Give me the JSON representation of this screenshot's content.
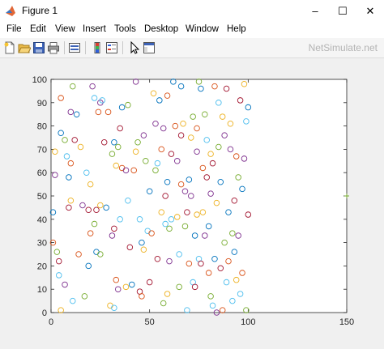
{
  "window": {
    "title": "Figure 1",
    "controls": [
      "–",
      "☐",
      "✕"
    ]
  },
  "menu": [
    "File",
    "Edit",
    "View",
    "Insert",
    "Tools",
    "Desktop",
    "Window",
    "Help"
  ],
  "toolbar": {
    "watermark": "NetSimulate.net",
    "icons": [
      "new-figure-icon",
      "open-file-icon",
      "save-icon",
      "print-icon",
      "link-plot-icon",
      "insert-colorbar-icon",
      "insert-legend-icon",
      "edit-plot-icon",
      "property-inspector-icon"
    ]
  },
  "chart_data": {
    "type": "scatter",
    "title": "",
    "xlabel": "",
    "ylabel": "",
    "xlim": [
      0,
      150
    ],
    "ylim": [
      0,
      100
    ],
    "xticks": [
      0,
      50,
      100,
      150
    ],
    "yticks": [
      0,
      10,
      20,
      30,
      40,
      50,
      60,
      70,
      80,
      90,
      100
    ],
    "marker": "circle-open",
    "grid": false,
    "colors": [
      "#0072BD",
      "#D95319",
      "#EDB120",
      "#7E2F8E",
      "#77AC30",
      "#4DBEEE",
      "#A2142F"
    ],
    "extra_marker": {
      "x": 150,
      "y": 50,
      "symbol": "+",
      "color": "#77AC30"
    },
    "points": [
      [
        1,
        43
      ],
      [
        1,
        30
      ],
      [
        2,
        69
      ],
      [
        2,
        59
      ],
      [
        3,
        26
      ],
      [
        4,
        16
      ],
      [
        4,
        22
      ],
      [
        5,
        77
      ],
      [
        5,
        92
      ],
      [
        5,
        1
      ],
      [
        7,
        12
      ],
      [
        7,
        74
      ],
      [
        8,
        67
      ],
      [
        9,
        45
      ],
      [
        9,
        58
      ],
      [
        10,
        64
      ],
      [
        10,
        48
      ],
      [
        10,
        86
      ],
      [
        11,
        97
      ],
      [
        11,
        5
      ],
      [
        12,
        74
      ],
      [
        13,
        85
      ],
      [
        14,
        25
      ],
      [
        15,
        71
      ],
      [
        16,
        46
      ],
      [
        17,
        7
      ],
      [
        18,
        60
      ],
      [
        19,
        44
      ],
      [
        19,
        20
      ],
      [
        20,
        34
      ],
      [
        20,
        55
      ],
      [
        21,
        97
      ],
      [
        22,
        38
      ],
      [
        22,
        92
      ],
      [
        23,
        44
      ],
      [
        23,
        26
      ],
      [
        24,
        86
      ],
      [
        25,
        46
      ],
      [
        25,
        90
      ],
      [
        25,
        25
      ],
      [
        26,
        91
      ],
      [
        27,
        73
      ],
      [
        28,
        45
      ],
      [
        29,
        86
      ],
      [
        30,
        3
      ],
      [
        31,
        33
      ],
      [
        31,
        68
      ],
      [
        32,
        2
      ],
      [
        32,
        36
      ],
      [
        32,
        73
      ],
      [
        33,
        14
      ],
      [
        33,
        63
      ],
      [
        34,
        10
      ],
      [
        34,
        71
      ],
      [
        35,
        40
      ],
      [
        35,
        79
      ],
      [
        36,
        88
      ],
      [
        36,
        62
      ],
      [
        38,
        11
      ],
      [
        38,
        61
      ],
      [
        39,
        89
      ],
      [
        39,
        48
      ],
      [
        40,
        28
      ],
      [
        41,
        12
      ],
      [
        42,
        61
      ],
      [
        43,
        69
      ],
      [
        43,
        99
      ],
      [
        44,
        73
      ],
      [
        45,
        40
      ],
      [
        45,
        9
      ],
      [
        46,
        30
      ],
      [
        46,
        7
      ],
      [
        47,
        27
      ],
      [
        47,
        76
      ],
      [
        48,
        65
      ],
      [
        49,
        35
      ],
      [
        50,
        13
      ],
      [
        50,
        52
      ],
      [
        51,
        34
      ],
      [
        52,
        94
      ],
      [
        53,
        81
      ],
      [
        53,
        61
      ],
      [
        54,
        64
      ],
      [
        54,
        23
      ],
      [
        55,
        91
      ],
      [
        56,
        70
      ],
      [
        56,
        43
      ],
      [
        57,
        79
      ],
      [
        57,
        4
      ],
      [
        58,
        38
      ],
      [
        58,
        50
      ],
      [
        59,
        56
      ],
      [
        59,
        93
      ],
      [
        59,
        8
      ],
      [
        60,
        22
      ],
      [
        60,
        36
      ],
      [
        61,
        40
      ],
      [
        61,
        68
      ],
      [
        62,
        99
      ],
      [
        63,
        80
      ],
      [
        64,
        41
      ],
      [
        64,
        65
      ],
      [
        65,
        11
      ],
      [
        65,
        25
      ],
      [
        66,
        76
      ],
      [
        66,
        97
      ],
      [
        66,
        55
      ],
      [
        67,
        81
      ],
      [
        68,
        52
      ],
      [
        68,
        37
      ],
      [
        69,
        1
      ],
      [
        69,
        43
      ],
      [
        70,
        57
      ],
      [
        70,
        21
      ],
      [
        71,
        75
      ],
      [
        71,
        50
      ],
      [
        72,
        84
      ],
      [
        72,
        13
      ],
      [
        73,
        11
      ],
      [
        73,
        33
      ],
      [
        74,
        79
      ],
      [
        74,
        42
      ],
      [
        74,
        69
      ],
      [
        75,
        99
      ],
      [
        75,
        23
      ],
      [
        76,
        21
      ],
      [
        76,
        96
      ],
      [
        77,
        62
      ],
      [
        77,
        43
      ],
      [
        78,
        33
      ],
      [
        78,
        85
      ],
      [
        79,
        74
      ],
      [
        79,
        58
      ],
      [
        80,
        37
      ],
      [
        80,
        17
      ],
      [
        81,
        68
      ],
      [
        81,
        51
      ],
      [
        81,
        7
      ],
      [
        82,
        3
      ],
      [
        82,
        64
      ],
      [
        83,
        23
      ],
      [
        83,
        97
      ],
      [
        84,
        47
      ],
      [
        84,
        0
      ],
      [
        85,
        71
      ],
      [
        85,
        90
      ],
      [
        86,
        19
      ],
      [
        86,
        56
      ],
      [
        87,
        1
      ],
      [
        87,
        84
      ],
      [
        88,
        76
      ],
      [
        88,
        30
      ],
      [
        89,
        13
      ],
      [
        89,
        96
      ],
      [
        90,
        43
      ],
      [
        90,
        22
      ],
      [
        91,
        81
      ],
      [
        91,
        70
      ],
      [
        92,
        34
      ],
      [
        92,
        5
      ],
      [
        93,
        48
      ],
      [
        93,
        26
      ],
      [
        94,
        67
      ],
      [
        94,
        14
      ],
      [
        95,
        33
      ],
      [
        95,
        58
      ],
      [
        96,
        8
      ],
      [
        96,
        91
      ],
      [
        97,
        53
      ],
      [
        97,
        17
      ],
      [
        98,
        98
      ],
      [
        98,
        66
      ],
      [
        99,
        1
      ],
      [
        99,
        82
      ],
      [
        100,
        42
      ],
      [
        100,
        88
      ]
    ]
  }
}
